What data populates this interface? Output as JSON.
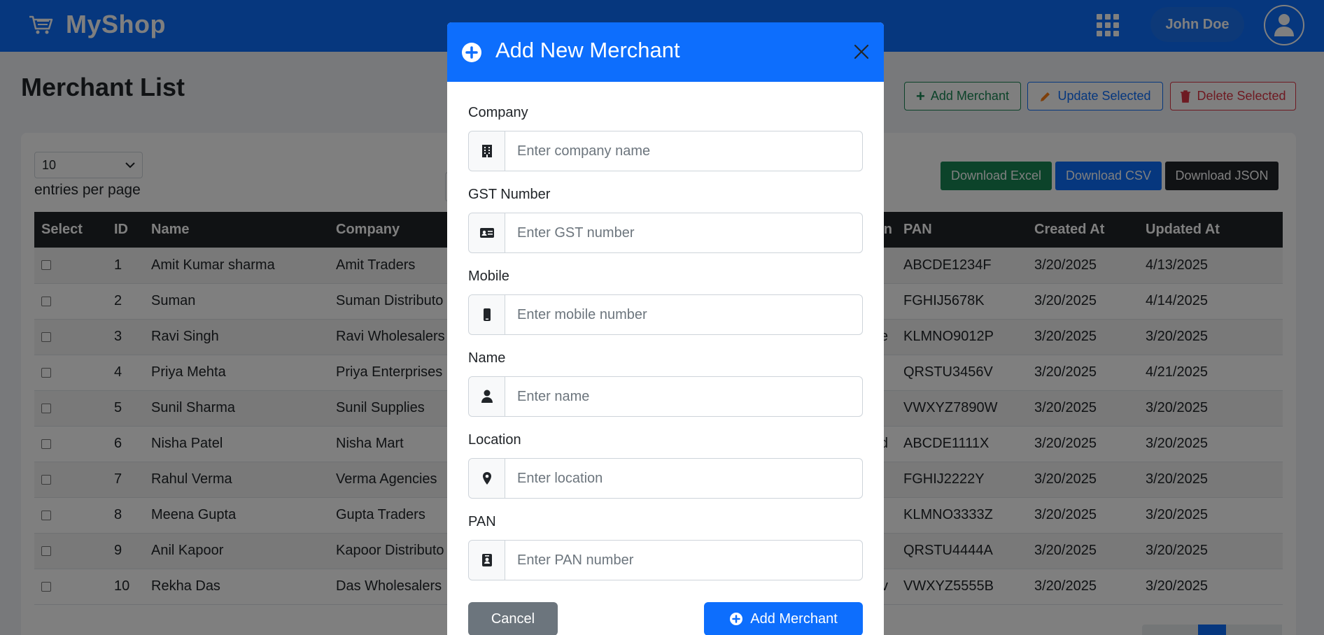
{
  "header": {
    "brand": "MyShop",
    "user_name": "John Doe"
  },
  "page": {
    "title": "Merchant List",
    "add_label": "Add Merchant",
    "update_label": "Update Selected",
    "delete_label": "Delete Selected"
  },
  "controls": {
    "entries_value": "10",
    "entries_label": "entries per page",
    "download_excel": "Download Excel",
    "download_csv": "Download CSV",
    "download_json": "Download JSON"
  },
  "table": {
    "columns": [
      "Select",
      "ID",
      "Name",
      "Company",
      "",
      "n",
      "PAN",
      "Created At",
      "Updated At"
    ],
    "rows": [
      {
        "id": "1",
        "name": "Amit Kumar sharma",
        "company": "Amit Traders",
        "loc": "",
        "pan": "ABCDE1234F",
        "created": "3/20/2025",
        "updated": "4/13/2025"
      },
      {
        "id": "2",
        "name": "Suman",
        "company": "Suman Distributo",
        "loc": "",
        "pan": "FGHIJ5678K",
        "created": "3/20/2025",
        "updated": "4/14/2025"
      },
      {
        "id": "3",
        "name": "Ravi Singh",
        "company": "Ravi Wholesalers",
        "loc": "re",
        "pan": "KLMNO9012P",
        "created": "3/20/2025",
        "updated": "3/20/2025"
      },
      {
        "id": "4",
        "name": "Priya Mehta",
        "company": "Priya Enterprises",
        "loc": "",
        "pan": "QRSTU3456V",
        "created": "3/20/2025",
        "updated": "4/21/2025"
      },
      {
        "id": "5",
        "name": "Sunil Sharma",
        "company": "Sunil Supplies",
        "loc": "",
        "pan": "VWXYZ7890W",
        "created": "3/20/2025",
        "updated": "3/20/2025"
      },
      {
        "id": "6",
        "name": "Nisha Patel",
        "company": "Nisha Mart",
        "loc": "bad",
        "pan": "ABCDE1111X",
        "created": "3/20/2025",
        "updated": "3/20/2025"
      },
      {
        "id": "7",
        "name": "Rahul Verma",
        "company": "Verma Agencies",
        "loc": "",
        "pan": "FGHIJ2222Y",
        "created": "3/20/2025",
        "updated": "3/20/2025"
      },
      {
        "id": "8",
        "name": "Meena Gupta",
        "company": "Gupta Traders",
        "loc": "",
        "pan": "KLMNO3333Z",
        "created": "3/20/2025",
        "updated": "3/20/2025"
      },
      {
        "id": "9",
        "name": "Anil Kapoor",
        "company": "Kapoor Distributo",
        "loc": "",
        "pan": "QRSTU4444A",
        "created": "3/20/2025",
        "updated": "3/20/2025"
      },
      {
        "id": "10",
        "name": "Rekha Das",
        "company": "Das Wholesalers",
        "loc": "v",
        "pan": "VWXYZ5555B",
        "created": "3/20/2025",
        "updated": "3/20/2025"
      }
    ]
  },
  "modal": {
    "title": "Add New Merchant",
    "fields": {
      "company": {
        "label": "Company",
        "placeholder": "Enter company name",
        "value": ""
      },
      "gst": {
        "label": "GST Number",
        "placeholder": "Enter GST number",
        "value": ""
      },
      "mobile": {
        "label": "Mobile",
        "placeholder": "Enter mobile number",
        "value": ""
      },
      "name": {
        "label": "Name",
        "placeholder": "Enter name",
        "value": ""
      },
      "location": {
        "label": "Location",
        "placeholder": "Enter location",
        "value": ""
      },
      "pan": {
        "label": "PAN",
        "placeholder": "Enter PAN number",
        "value": ""
      }
    },
    "cancel_label": "Cancel",
    "submit_label": "Add Merchant"
  },
  "colors": {
    "primary": "#0d6efd",
    "success": "#198754",
    "danger": "#dc3545",
    "dark": "#212529",
    "secondary": "#6c757d"
  }
}
